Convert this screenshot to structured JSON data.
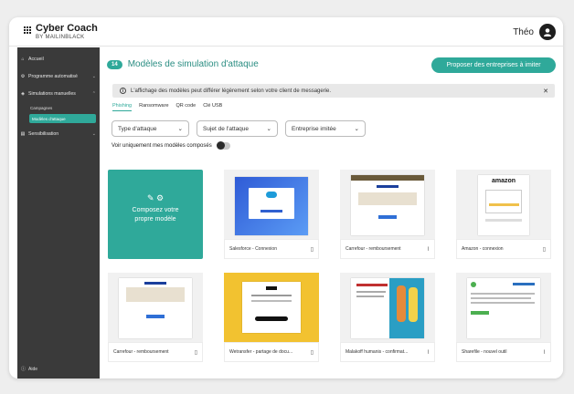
{
  "brand": {
    "title": "Cyber Coach",
    "subtitle": "BY MAILINBLACK"
  },
  "user": {
    "name": "Théo"
  },
  "sidebar": {
    "items": [
      {
        "label": "Accueil"
      },
      {
        "label": "Programme automatisé"
      },
      {
        "label": "Simulations manuelles"
      },
      {
        "label": "Sensibilisation"
      }
    ],
    "subitems": [
      {
        "label": "Campagnes"
      },
      {
        "label": "Modèles d'attaque"
      }
    ],
    "help": "Aide"
  },
  "header": {
    "count": "14",
    "title": "Modèles de simulation d'attaque",
    "propose_button": "Proposer des entreprises à imiter"
  },
  "notice": {
    "text": "L'affichage des modèles peut différer légèrement selon votre client de messagerie."
  },
  "tabs": [
    {
      "label": "Phishing"
    },
    {
      "label": "Ransomware"
    },
    {
      "label": "QR code"
    },
    {
      "label": "Clé USB"
    }
  ],
  "filters": [
    {
      "label": "Type d'attaque"
    },
    {
      "label": "Sujet de l'attaque"
    },
    {
      "label": "Entreprise imitée"
    }
  ],
  "toggle": {
    "label": "Voir uniquement mes modèles composés"
  },
  "compose_card": {
    "line1": "Composez votre",
    "line2": "propre modèle"
  },
  "cards": [
    {
      "label": "Salesforce - Connexion",
      "icon": "document-icon"
    },
    {
      "label": "Carrefour - remboursement",
      "icon": "paperclip-icon"
    },
    {
      "label": "Amazon - connexion",
      "icon": "document-icon"
    },
    {
      "label": "Carrefour - remboursement",
      "icon": "document-icon"
    },
    {
      "label": "Wetransfer - partage de docu...",
      "icon": "document-icon"
    },
    {
      "label": "Malakoff humanis - confirmat...",
      "icon": "paperclip-icon"
    },
    {
      "label": "Sharefile - nouvel outil",
      "icon": "paperclip-icon"
    }
  ],
  "thumbnail_text": {
    "amazon_logo": "amazon"
  },
  "colors": {
    "accent": "#2fa99a",
    "sidebar": "#3a3a3a"
  }
}
